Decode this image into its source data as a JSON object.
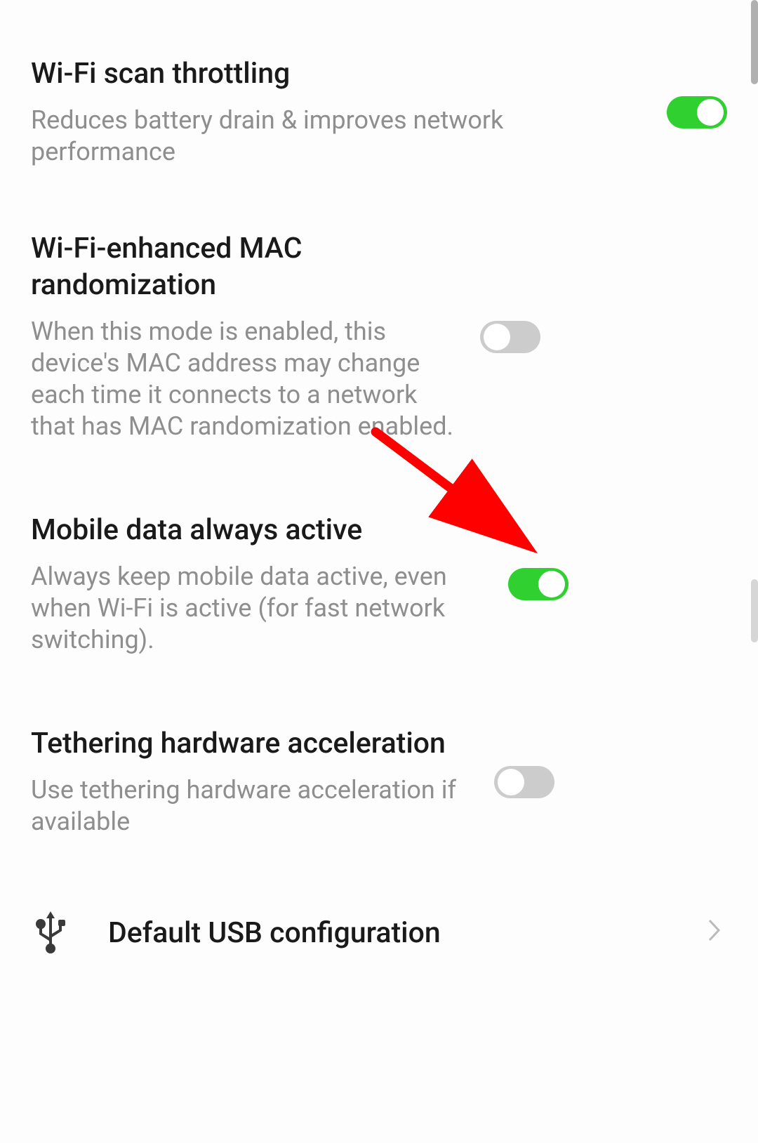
{
  "settings": [
    {
      "title": "Wi-Fi scan throttling",
      "desc": "Reduces battery drain & improves network performance",
      "enabled": true
    },
    {
      "title": "Wi-Fi-enhanced MAC randomization",
      "desc": "When this mode is enabled, this device's MAC address may change each time it connects to a network that has MAC randomization enabled.",
      "enabled": false
    },
    {
      "title": "Mobile data always active",
      "desc": "Always keep mobile data active, even when Wi-Fi is active (for fast network switching).",
      "enabled": true
    },
    {
      "title": "Tethering hardware acceleration",
      "desc": "Use tethering hardware acceleration if available",
      "enabled": false
    }
  ],
  "navItem": {
    "label": "Default USB configuration"
  },
  "colors": {
    "toggle_on": "#2fd02f",
    "toggle_off": "#cccccc",
    "arrow": "#fe0000"
  }
}
